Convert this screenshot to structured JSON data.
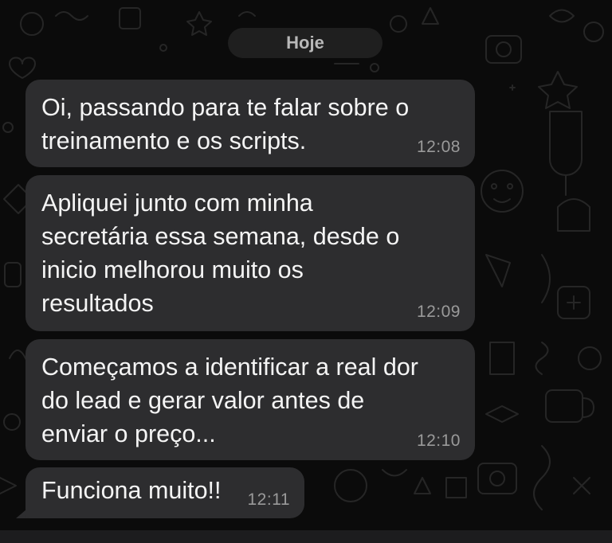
{
  "chat": {
    "date_separator": "Hoje",
    "messages": [
      {
        "text": "Oi, passando para te falar sobre o\ntreinamento e os scripts.",
        "time": "12:08"
      },
      {
        "text": "Apliquei junto com minha\nsecretária essa semana, desde o\ninicio melhorou muito os\nresultados",
        "time": "12:09"
      },
      {
        "text": "Começamos a identificar a real dor\ndo lead e gerar valor antes de\nenviar o preço...",
        "time": "12:10"
      },
      {
        "text": "Funciona muito!!",
        "time": "12:11"
      }
    ]
  },
  "colors": {
    "background": "#0b0b0b",
    "bubble": "#2d2d2f",
    "text": "#f4f4f4",
    "timestamp": "#9a9a9a",
    "doodle": "#262626"
  }
}
